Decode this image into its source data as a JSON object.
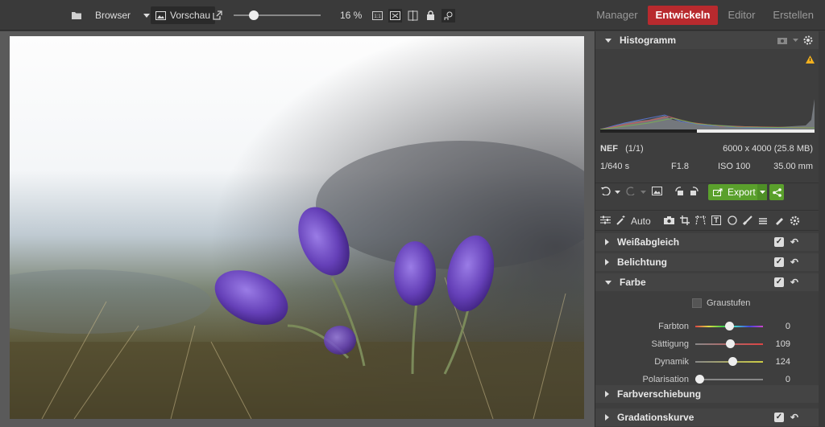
{
  "toolbar": {
    "browser_label": "Browser",
    "preview_label": "Vorschau",
    "zoom": "16 %",
    "zoom_fraction": 0.2
  },
  "modes": [
    {
      "label": "Manager",
      "active": false
    },
    {
      "label": "Entwickeln",
      "active": true
    },
    {
      "label": "Editor",
      "active": false
    },
    {
      "label": "Erstellen",
      "active": false
    }
  ],
  "histogram": {
    "title": "Histogramm"
  },
  "info": {
    "format": "NEF",
    "count": "(1/1)",
    "dimensions": "6000 x 4000 (25.8 MB)",
    "shutter": "1/640 s",
    "aperture": "F1.8",
    "iso": "ISO 100",
    "focal": "35.00 mm"
  },
  "actions": {
    "export_label": "Export"
  },
  "tools": {
    "auto_label": "Auto"
  },
  "sections": {
    "white_balance": "Weißabgleich",
    "exposure": "Belichtung",
    "color": "Farbe",
    "color_shift": "Farbverschiebung",
    "tone_curve": "Gradationskurve"
  },
  "color": {
    "grayscale_label": "Graustufen",
    "sliders": [
      {
        "label": "Farbton",
        "value": "0",
        "level": 0.5
      },
      {
        "label": "Sättigung",
        "value": "109",
        "level": 0.52
      },
      {
        "label": "Dynamik",
        "value": "124",
        "level": 0.56
      },
      {
        "label": "Polarisation",
        "value": "0",
        "level": 0.0
      }
    ]
  },
  "colors": {
    "accent_red": "#b82a2e",
    "export_green": "#5aa02c"
  },
  "icons": [
    "folder-icon",
    "dropdown-icon",
    "image-icon",
    "external-link-icon",
    "zoom-1to1-icon",
    "fit-icon",
    "compare-icon",
    "lock-icon",
    "person-search-icon",
    "camera-icon",
    "gear-icon",
    "warning-icon",
    "undo-icon",
    "redo-icon",
    "crop-icon",
    "share-icon"
  ]
}
